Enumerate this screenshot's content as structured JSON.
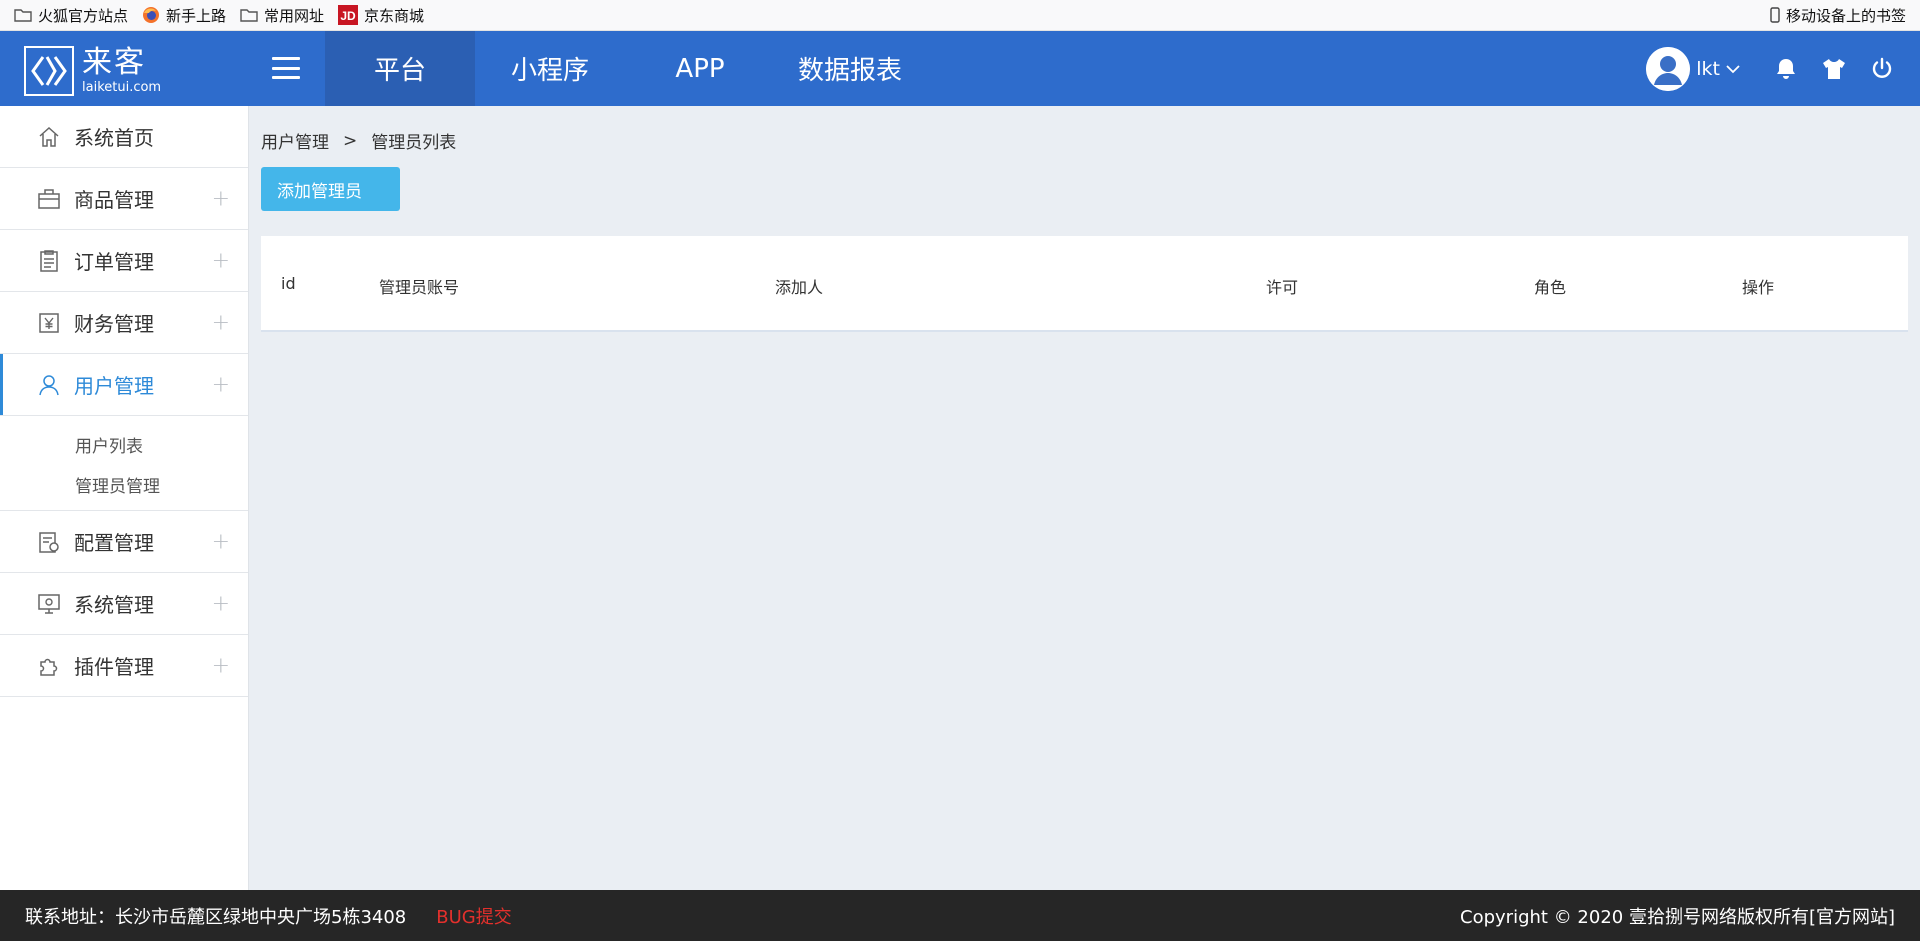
{
  "bookmarks": {
    "items": [
      {
        "label": "火狐官方站点",
        "icon": "folder-icon"
      },
      {
        "label": "新手上路",
        "icon": "firefox-icon"
      },
      {
        "label": "常用网址",
        "icon": "folder-icon"
      },
      {
        "label": "京东商城",
        "icon": "jd-icon"
      }
    ],
    "mobile_label": "移动设备上的书签"
  },
  "header": {
    "logo_name": "来客",
    "logo_domain": "laiketui.com",
    "nav": [
      "平台",
      "小程序",
      "APP",
      "数据报表"
    ],
    "active_nav": "平台",
    "username": "lkt",
    "brand_color": "#2e6ccc"
  },
  "sidebar": {
    "items": [
      {
        "label": "系统首页",
        "icon": "home-icon",
        "expandable": false
      },
      {
        "label": "商品管理",
        "icon": "bag-icon",
        "expandable": true
      },
      {
        "label": "订单管理",
        "icon": "clipboard-icon",
        "expandable": true
      },
      {
        "label": "财务管理",
        "icon": "yen-icon",
        "expandable": true
      },
      {
        "label": "用户管理",
        "icon": "user-icon",
        "expandable": true,
        "active": true
      },
      {
        "label": "配置管理",
        "icon": "config-icon",
        "expandable": true
      },
      {
        "label": "系统管理",
        "icon": "monitor-icon",
        "expandable": true
      },
      {
        "label": "插件管理",
        "icon": "puzzle-icon",
        "expandable": true
      }
    ],
    "submenu": [
      "用户列表",
      "管理员管理"
    ],
    "plus_glyph": "+"
  },
  "main": {
    "breadcrumb": [
      "用户管理",
      "管理员列表"
    ],
    "breadcrumb_sep": ">",
    "add_button": "添加管理员",
    "table_headers": [
      "id",
      "管理员账号",
      "添加人",
      "许可",
      "角色",
      "操作"
    ]
  },
  "footer": {
    "address": "联系地址：长沙市岳麓区绿地中央广场5栋3408",
    "bug": "BUG提交",
    "copyright": "Copyright © 2020 壹拾捌号网络版权所有[官方网站]"
  }
}
